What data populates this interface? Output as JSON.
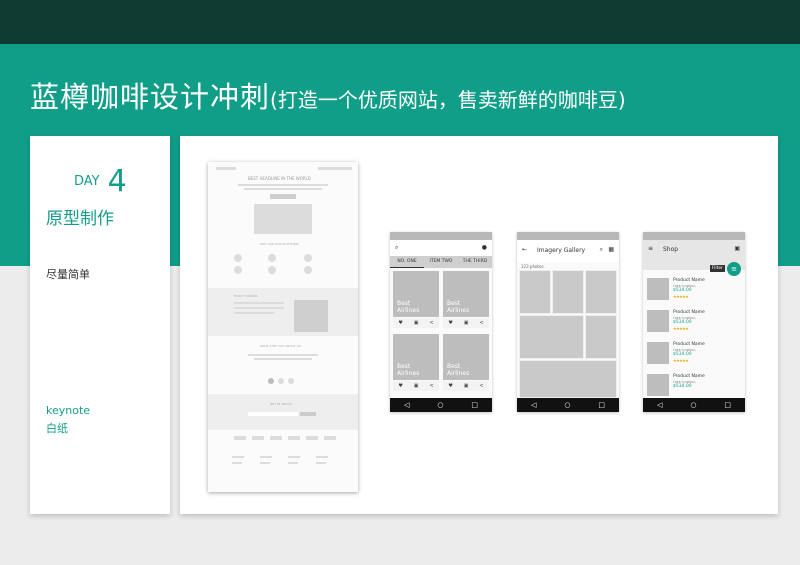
{
  "header": {
    "title": "蓝樽咖啡设计冲刺",
    "subtitle": "(打造一个优质网站，售卖新鲜的咖啡豆)"
  },
  "left_card": {
    "day_label": "DAY",
    "day_number": "4",
    "stage": "原型制作",
    "description": "尽量简单",
    "tools": [
      "keynote",
      "白纸"
    ]
  },
  "website_wireframe": {
    "headline": "BEST HEADLINE IN THE WORLD",
    "section2": "WHY USE OUR PLATFORM",
    "section3": "HOW IT WORKS",
    "section4": "WHAT THEY SAY ABOUT US",
    "section5": "GET IN TOUCH"
  },
  "phone1": {
    "tabs": [
      "NO. ONE",
      "ITEM TWO",
      "THE THIRD"
    ],
    "tile_caption_1": "Best",
    "tile_caption_2": "Airlines"
  },
  "phone2": {
    "title": "Imagery Gallery",
    "count": "123 photos"
  },
  "phone3": {
    "title": "Shop",
    "tooltip": "Filter",
    "products": [
      {
        "name": "Product Name",
        "ship": "FREE SHIPPING",
        "price": "$534.00"
      },
      {
        "name": "Product Name",
        "ship": "FREE SHIPPING",
        "price": "$534.00"
      },
      {
        "name": "Product Name",
        "ship": "FREE SHIPPING",
        "price": "$534.00"
      },
      {
        "name": "Product Name",
        "ship": "FREE SHIPPING",
        "price": "$534.00"
      }
    ]
  },
  "icons": {
    "nav_back": "◁",
    "nav_home": "○",
    "nav_recent": "□",
    "heart": "♥",
    "cart": "🛒",
    "share": "<"
  },
  "colors": {
    "accent": "#119e89",
    "dark": "#0f3b33"
  }
}
